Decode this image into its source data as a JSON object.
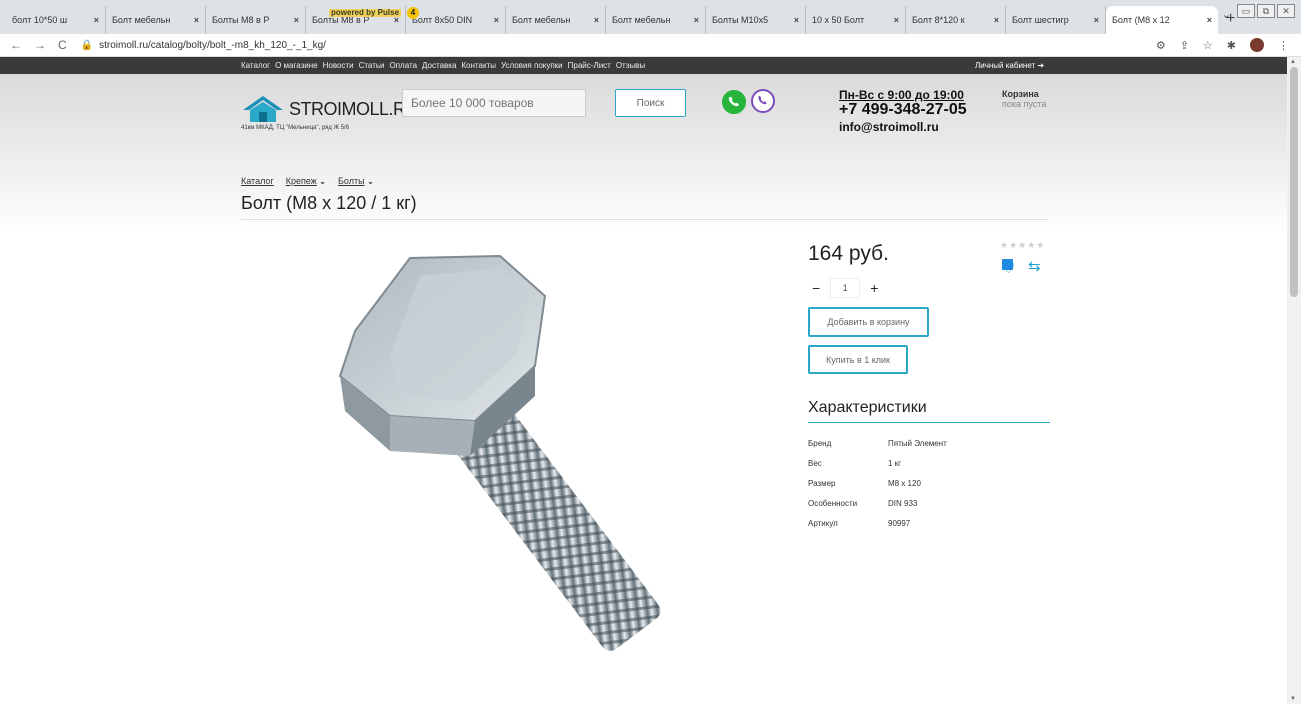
{
  "browser": {
    "tabs": [
      {
        "title": "болт 10*50 ш",
        "color": "#4285f4"
      },
      {
        "title": "Болт мебельн",
        "color": "#888888"
      },
      {
        "title": "Болты М8 в Р",
        "color": "#1e88e5"
      },
      {
        "title": "Болты М8 в Р",
        "color": "#1e88e5"
      },
      {
        "title": "Болт 8x50 DIN",
        "color": "#555555"
      },
      {
        "title": "Болт мебельн",
        "color": "#3f6fb6"
      },
      {
        "title": "Болт мебельн",
        "color": "#6bbf3a"
      },
      {
        "title": "Болты М10x5",
        "color": "#d32f2f"
      },
      {
        "title": "10 x 50 Болт",
        "color": "#c62828"
      },
      {
        "title": "Болт 8*120 к",
        "color": "#4285f4"
      },
      {
        "title": "Болт шестигр",
        "color": "#888888"
      },
      {
        "title": "Болт (М8 x 12",
        "color": "#1e88e5"
      }
    ],
    "url": "stroimoll.ru/catalog/bolty/bolt_-m8_kh_120_-_1_kg/"
  },
  "topnav": {
    "links": [
      "Каталог",
      "О магазине",
      "Новости",
      "Статьи",
      "Оплата",
      "Доставка",
      "Контакты",
      "Условия покупки",
      "Прайс-Лист",
      "Отзывы"
    ],
    "powered": "powered by Pulse",
    "badge": "4",
    "cabinet": "Личный кабинет"
  },
  "header": {
    "logo": "STROIMOLL.RU",
    "logo_sub": "41км МКАД, ТЦ \"Мельница\", ряд Ж 5/6",
    "search_placeholder": "Более 10 000 товаров",
    "search_button": "Поиск",
    "hours": "Пн-Вс с 9:00 до 19:00",
    "phone": "+7 499-348-27-05",
    "email": "info@stroimoll.ru",
    "cart_title": "Корзина",
    "cart_sub": "пока пуста"
  },
  "breadcrumbs": [
    "Каталог",
    "Крепеж",
    "Болты"
  ],
  "product": {
    "title": "Болт (М8 x 120 / 1 кг)",
    "price": "164 руб.",
    "qty": "1",
    "add_to_cart": "Добавить в корзину",
    "buy_one_click": "Купить в 1 клик",
    "chars_title": "Характеристики",
    "chars": [
      {
        "k": "Бренд",
        "v": "Пятый Элемент"
      },
      {
        "k": "Вес",
        "v": "1 кг"
      },
      {
        "k": "Размер",
        "v": "М8 x 120"
      },
      {
        "k": "Особенности",
        "v": "DIN 933"
      },
      {
        "k": "Артикул",
        "v": "90997"
      }
    ]
  }
}
